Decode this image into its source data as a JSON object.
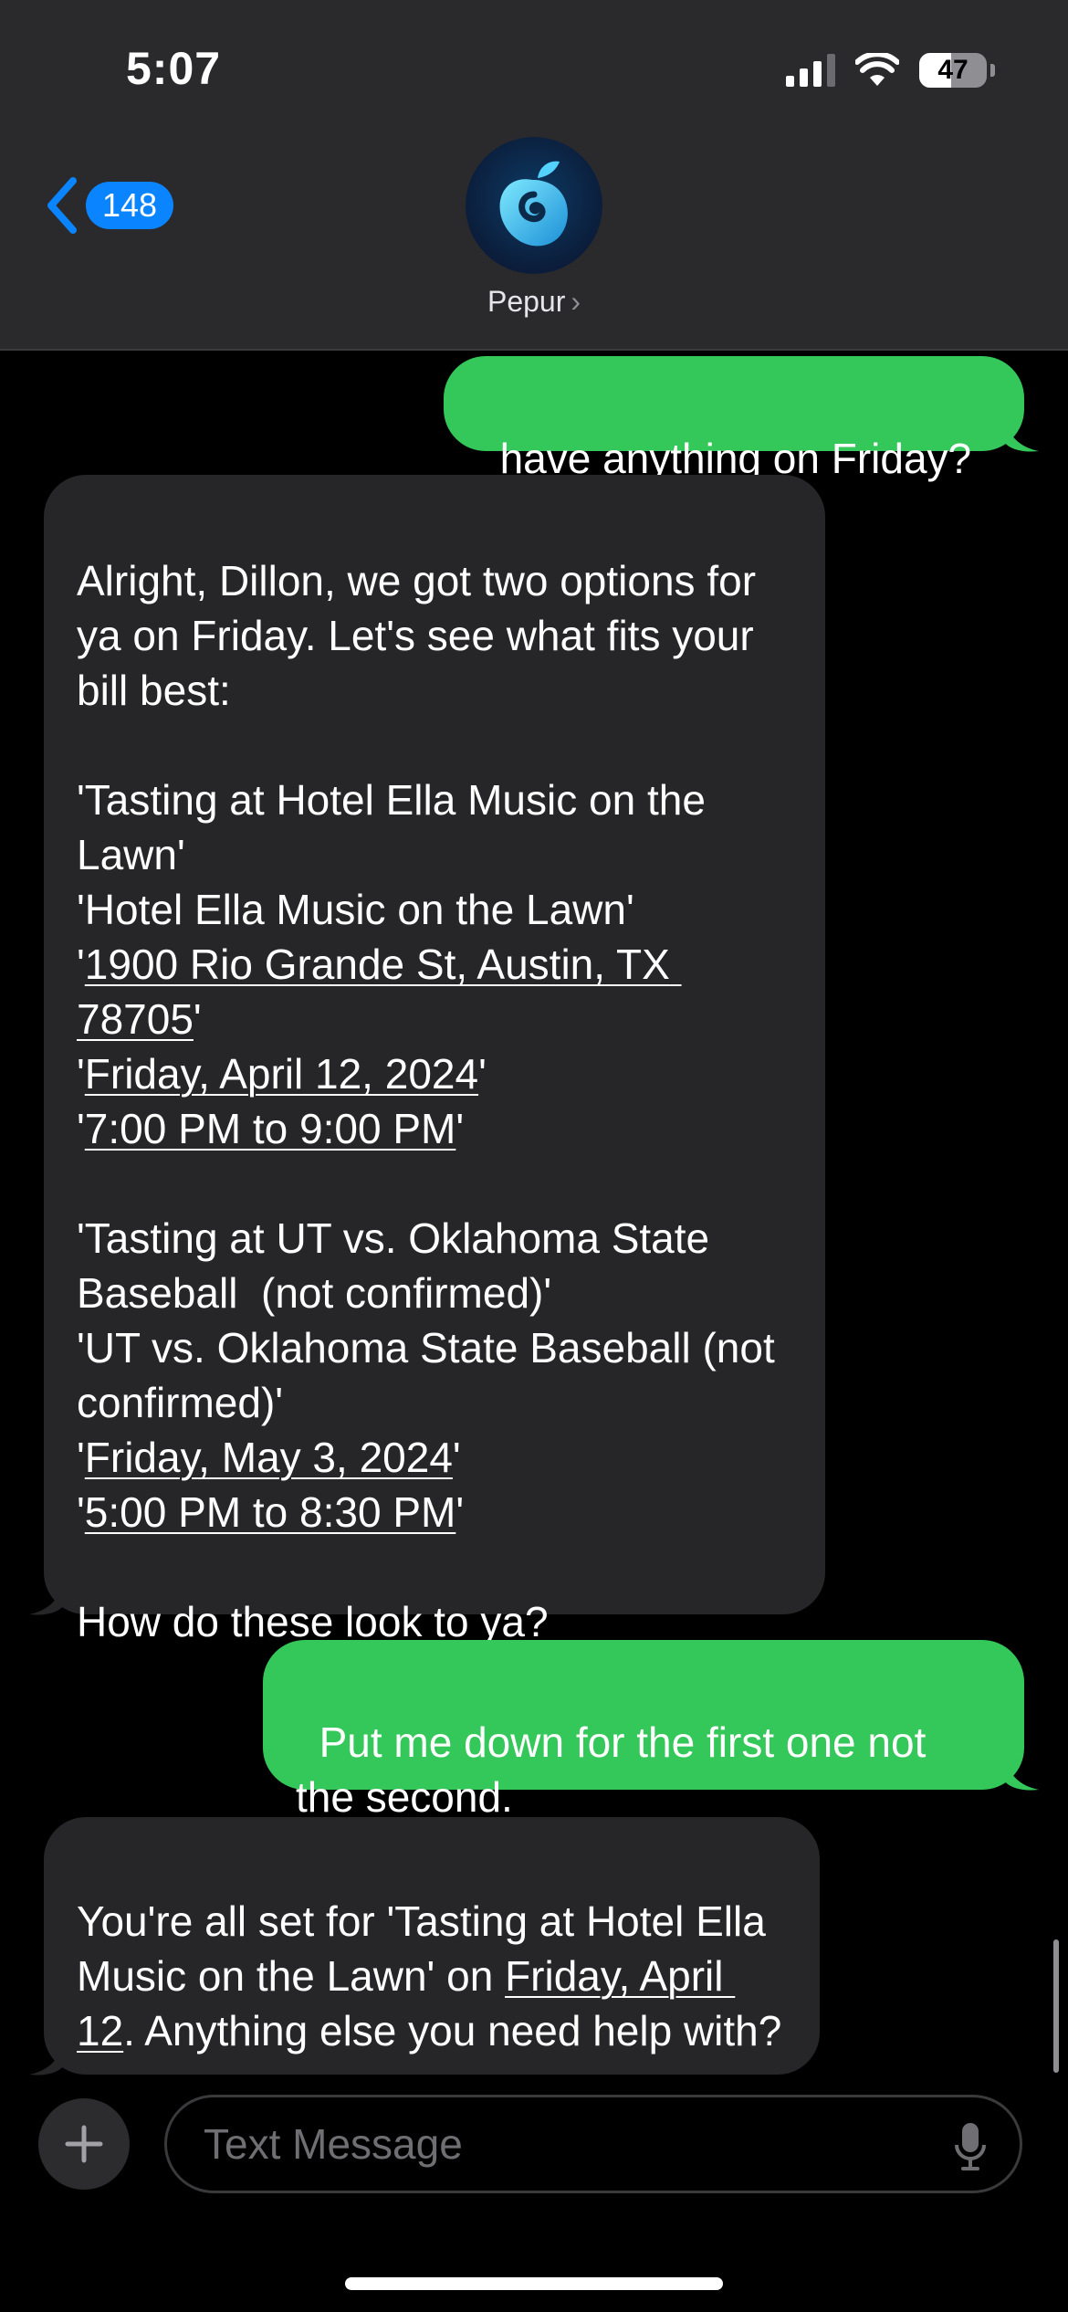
{
  "status_bar": {
    "time": "5:07",
    "battery_percent": "47",
    "battery_level": 0.47,
    "signal_bars_on": 3,
    "signal_bars_total": 4
  },
  "header": {
    "back_count": "148",
    "contact_name": "Pepur",
    "chevron": "›"
  },
  "messages": [
    {
      "direction": "outgoing",
      "text": "have anything on Friday?"
    },
    {
      "direction": "incoming",
      "lines": {
        "intro": "Alright, Dillon, we got two options for ya on Friday. Let's see what fits your bill best:",
        "e1_title": "'Tasting at Hotel Ella Music on the Lawn'",
        "e1_venue": "'Hotel Ella Music on the Lawn'",
        "e1_address": "1900 Rio Grande St, Austin, TX 78705",
        "e1_date": "Friday, April 12, 2024",
        "e1_time": "7:00 PM to 9:00 PM",
        "e2_title": "'Tasting at UT vs. Oklahoma State Baseball  (not confirmed)'",
        "e2_venue": "'UT vs. Oklahoma State Baseball (not confirmed)'",
        "e2_date": "Friday, May 3, 2024",
        "e2_time": "5:00 PM to 8:30 PM",
        "outro": "How do these look to ya?"
      }
    },
    {
      "direction": "outgoing",
      "text": "Put me down for the first one not the second."
    },
    {
      "direction": "incoming",
      "lines": {
        "before": "You're all set for 'Tasting at Hotel Ella Music on the Lawn' on ",
        "date": "Friday, April 12",
        "after": ". Anything else you need help with?"
      }
    }
  ],
  "composer": {
    "placeholder": "Text Message"
  },
  "icons": {
    "back": "chevron-left-icon",
    "avatar": "peach-logo-icon",
    "add": "plus-icon",
    "mic": "microphone-icon",
    "wifi": "wifi-icon",
    "signal": "cellular-signal-icon",
    "battery": "battery-icon"
  },
  "colors": {
    "outgoing": "#34c759",
    "incoming": "#262628",
    "accent": "#0a84ff",
    "header_bg": "#2a2a2c"
  }
}
